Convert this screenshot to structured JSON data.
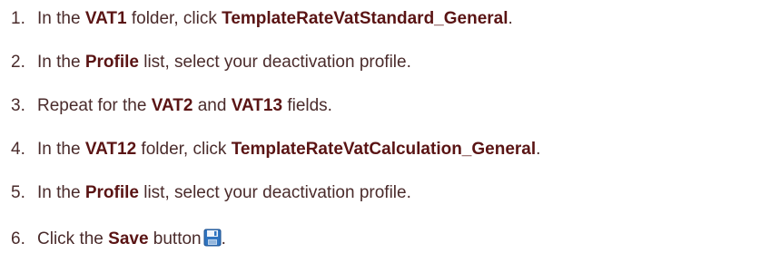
{
  "steps": [
    {
      "number": "1.",
      "parts": [
        "In the ",
        "VAT1",
        " folder, click ",
        "TemplateRateVatStandard_General",
        "."
      ]
    },
    {
      "number": "2.",
      "parts": [
        "In the ",
        "Profile",
        " list, select your deactivation profile."
      ]
    },
    {
      "number": "3.",
      "parts": [
        "Repeat for the ",
        "VAT2",
        " and ",
        "VAT13",
        " fields."
      ]
    },
    {
      "number": "4.",
      "parts": [
        "In the ",
        "VAT12",
        " folder, click ",
        "TemplateRateVatCalculation_General",
        "."
      ]
    },
    {
      "number": "5.",
      "parts": [
        "In the ",
        "Profile",
        " list, select your deactivation profile."
      ]
    },
    {
      "number": "6.",
      "parts": [
        "Click the ",
        "Save",
        " button",
        "."
      ],
      "icon": "save-disk-icon"
    }
  ],
  "colors": {
    "text": "#4a2b2b",
    "emphasis": "#5a1414",
    "icon_blue": "#2f74c0"
  }
}
